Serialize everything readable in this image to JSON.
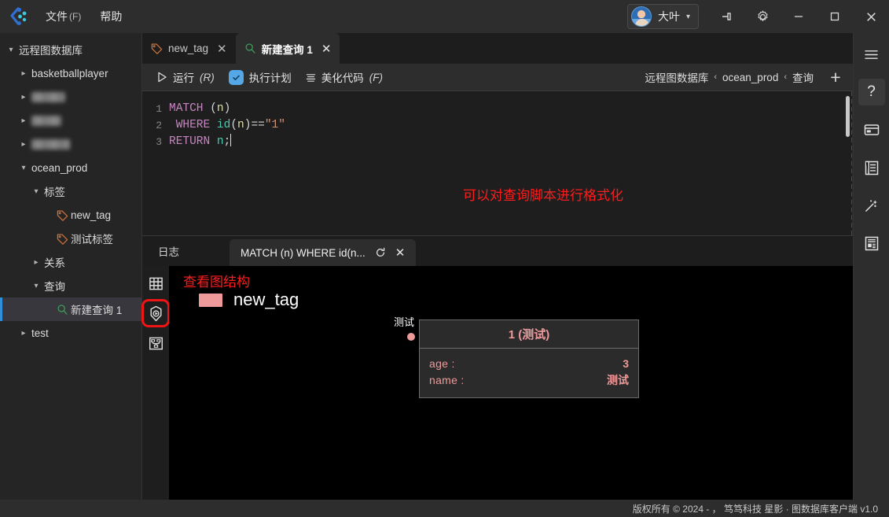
{
  "titlebar": {
    "logo_icon": "app-logo-icon",
    "menus": [
      {
        "label": "文件",
        "mnemonic": "(F)"
      },
      {
        "label": "帮助",
        "mnemonic": ""
      }
    ],
    "user": {
      "name": "大叶",
      "caret": "⌄"
    },
    "window_controls": {
      "pin": "pin-icon",
      "settings": "gear-icon",
      "minimize": "—",
      "maximize": "□",
      "close": "✕"
    }
  },
  "sidebar": {
    "items": [
      {
        "label": "远程图数据库",
        "depth": 0,
        "chev": "down",
        "icon": "",
        "redacted": false,
        "selected": false
      },
      {
        "label": "basketballplayer",
        "depth": 1,
        "chev": "right",
        "icon": "",
        "redacted": false,
        "selected": false
      },
      {
        "label": "",
        "depth": 1,
        "chev": "right",
        "icon": "",
        "redacted": true,
        "blur_width": 43,
        "selected": false
      },
      {
        "label": "",
        "depth": 1,
        "chev": "right",
        "icon": "",
        "redacted": true,
        "blur_width": 38,
        "selected": false
      },
      {
        "label": "",
        "depth": 1,
        "chev": "right",
        "icon": "",
        "redacted": true,
        "blur_width": 49,
        "selected": false
      },
      {
        "label": "ocean_prod",
        "depth": 1,
        "chev": "down",
        "icon": "",
        "redacted": false,
        "selected": false
      },
      {
        "label": "标签",
        "depth": 2,
        "chev": "down",
        "icon": "",
        "redacted": false,
        "selected": false
      },
      {
        "label": "new_tag",
        "depth": 3,
        "chev": "none",
        "icon": "tag-icon",
        "redacted": false,
        "selected": false
      },
      {
        "label": "测试标签",
        "depth": 3,
        "chev": "none",
        "icon": "tag-icon",
        "redacted": false,
        "selected": false
      },
      {
        "label": "关系",
        "depth": 2,
        "chev": "right",
        "icon": "",
        "redacted": false,
        "selected": false
      },
      {
        "label": "查询",
        "depth": 2,
        "chev": "down",
        "icon": "",
        "redacted": false,
        "selected": false
      },
      {
        "label": "新建查询 1",
        "depth": 3,
        "chev": "none",
        "icon": "search-icon",
        "redacted": false,
        "selected": true
      },
      {
        "label": "test",
        "depth": 1,
        "chev": "right",
        "icon": "",
        "redacted": false,
        "selected": false
      }
    ]
  },
  "editor_tabs": [
    {
      "label": "new_tag",
      "icon": "tag-icon",
      "active": false,
      "close": "✕"
    },
    {
      "label": "新建查询 1",
      "icon": "search-icon",
      "active": true,
      "close": "✕"
    }
  ],
  "query_toolbar": {
    "run": {
      "label": "运行",
      "mnemonic": "(R)",
      "icon": "play-icon"
    },
    "plan": {
      "label": "执行计划",
      "icon": "check-icon",
      "checked": true
    },
    "format": {
      "label": "美化代码",
      "mnemonic": "(F)",
      "icon": "lines-icon"
    },
    "breadcrumb": [
      "远程图数据库",
      "ocean_prod",
      "查询"
    ],
    "breadcrumb_sep": "‹",
    "new_tab": "+"
  },
  "editor": {
    "annotation": "可以对查询脚本进行格式化",
    "annotation_color": "#ff1c1c",
    "lines": [
      {
        "no": "1",
        "text": "MATCH (n)"
      },
      {
        "no": "2",
        "text": " WHERE id(n)==\"1\""
      },
      {
        "no": "3",
        "text": "RETURN n;"
      }
    ]
  },
  "result_panel": {
    "log_tab": "日志",
    "query_tab": {
      "label": "MATCH (n) WHERE id(n...",
      "refresh_icon": "refresh-icon",
      "close_icon": "✕"
    },
    "view_icons": [
      {
        "name": "table-view-icon",
        "active": false
      },
      {
        "name": "graph-view-icon",
        "active": true
      },
      {
        "name": "tree-view-icon",
        "active": false
      }
    ],
    "graph": {
      "annotation": "查看图结构",
      "annotation_color": "#ff1c1c",
      "legend": {
        "label": "new_tag",
        "color": "#ef9a9a"
      },
      "node": {
        "label": "测试",
        "color": "#ef9a9a"
      },
      "card": {
        "title": "1 (测试)",
        "properties": [
          {
            "key": "age :",
            "value": "3"
          },
          {
            "key": "name :",
            "value": "测试"
          }
        ]
      }
    }
  },
  "right_rail": [
    {
      "name": "hamburger-icon",
      "active": false
    },
    {
      "name": "help-icon",
      "glyph": "?",
      "active": true
    },
    {
      "name": "card-icon",
      "active": false
    },
    {
      "name": "list-icon",
      "active": false
    },
    {
      "name": "wand-icon",
      "active": false
    },
    {
      "name": "document-icon",
      "active": false
    }
  ],
  "statusbar": {
    "text": "版权所有 © 2024 - ，  笃笃科技   星影 · 图数据库客户端  v1.0"
  }
}
